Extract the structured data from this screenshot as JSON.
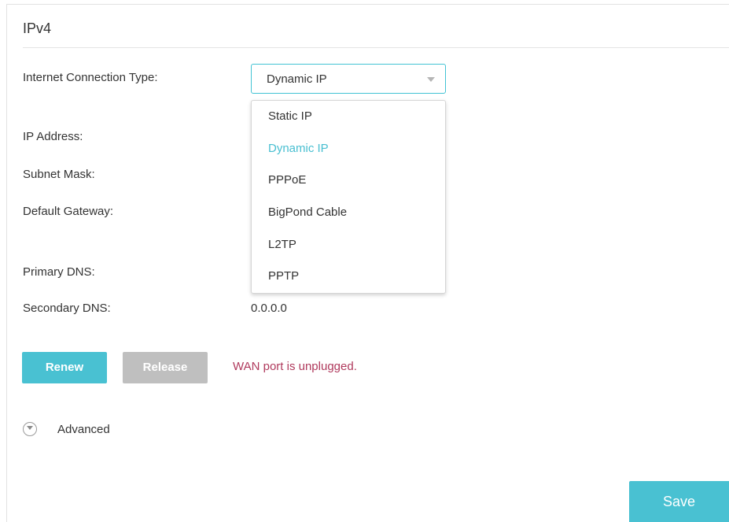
{
  "section": {
    "title": "IPv4"
  },
  "fields": {
    "connection_type_label": "Internet Connection Type:",
    "ip_address_label": "IP Address:",
    "subnet_mask_label": "Subnet Mask:",
    "default_gateway_label": "Default Gateway:",
    "primary_dns_label": "Primary DNS:",
    "secondary_dns_label": "Secondary DNS:",
    "secondary_dns_value": "0.0.0.0"
  },
  "connection_type": {
    "selected": "Dynamic IP",
    "options": [
      "Static IP",
      "Dynamic IP",
      "PPPoE",
      "BigPond Cable",
      "L2TP",
      "PPTP"
    ]
  },
  "actions": {
    "renew_label": "Renew",
    "release_label": "Release",
    "status_text": "WAN port is unplugged.",
    "advanced_label": "Advanced",
    "save_label": "Save"
  },
  "colors": {
    "accent": "#49c1d2",
    "disabled_button": "#bfbfbf",
    "status_text": "#b03a5d"
  }
}
